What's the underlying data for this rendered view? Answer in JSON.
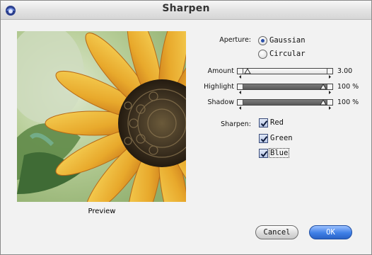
{
  "window": {
    "title": "Sharpen"
  },
  "preview": {
    "label": "Preview"
  },
  "aperture": {
    "label": "Aperture:",
    "options": [
      "Gaussian",
      "Circular"
    ],
    "selected": "Gaussian"
  },
  "sliders": [
    {
      "label": "Amount",
      "value_text": "3.00",
      "level": 0.03
    },
    {
      "label": "Highlight",
      "value_text": "100 %",
      "level": 1.0
    },
    {
      "label": "Shadow",
      "value_text": "100 %",
      "level": 1.0
    }
  ],
  "sharpen": {
    "label": "Sharpen:",
    "channels": [
      {
        "label": "Red",
        "checked": true
      },
      {
        "label": "Green",
        "checked": true
      },
      {
        "label": "Blue",
        "checked": true
      }
    ]
  },
  "buttons": {
    "cancel": "Cancel",
    "ok": "OK"
  },
  "colors": {
    "ok_button": "#3f7fe6",
    "radio_dot": "#2a4fa8",
    "preview_petal": "#e8a92c"
  }
}
